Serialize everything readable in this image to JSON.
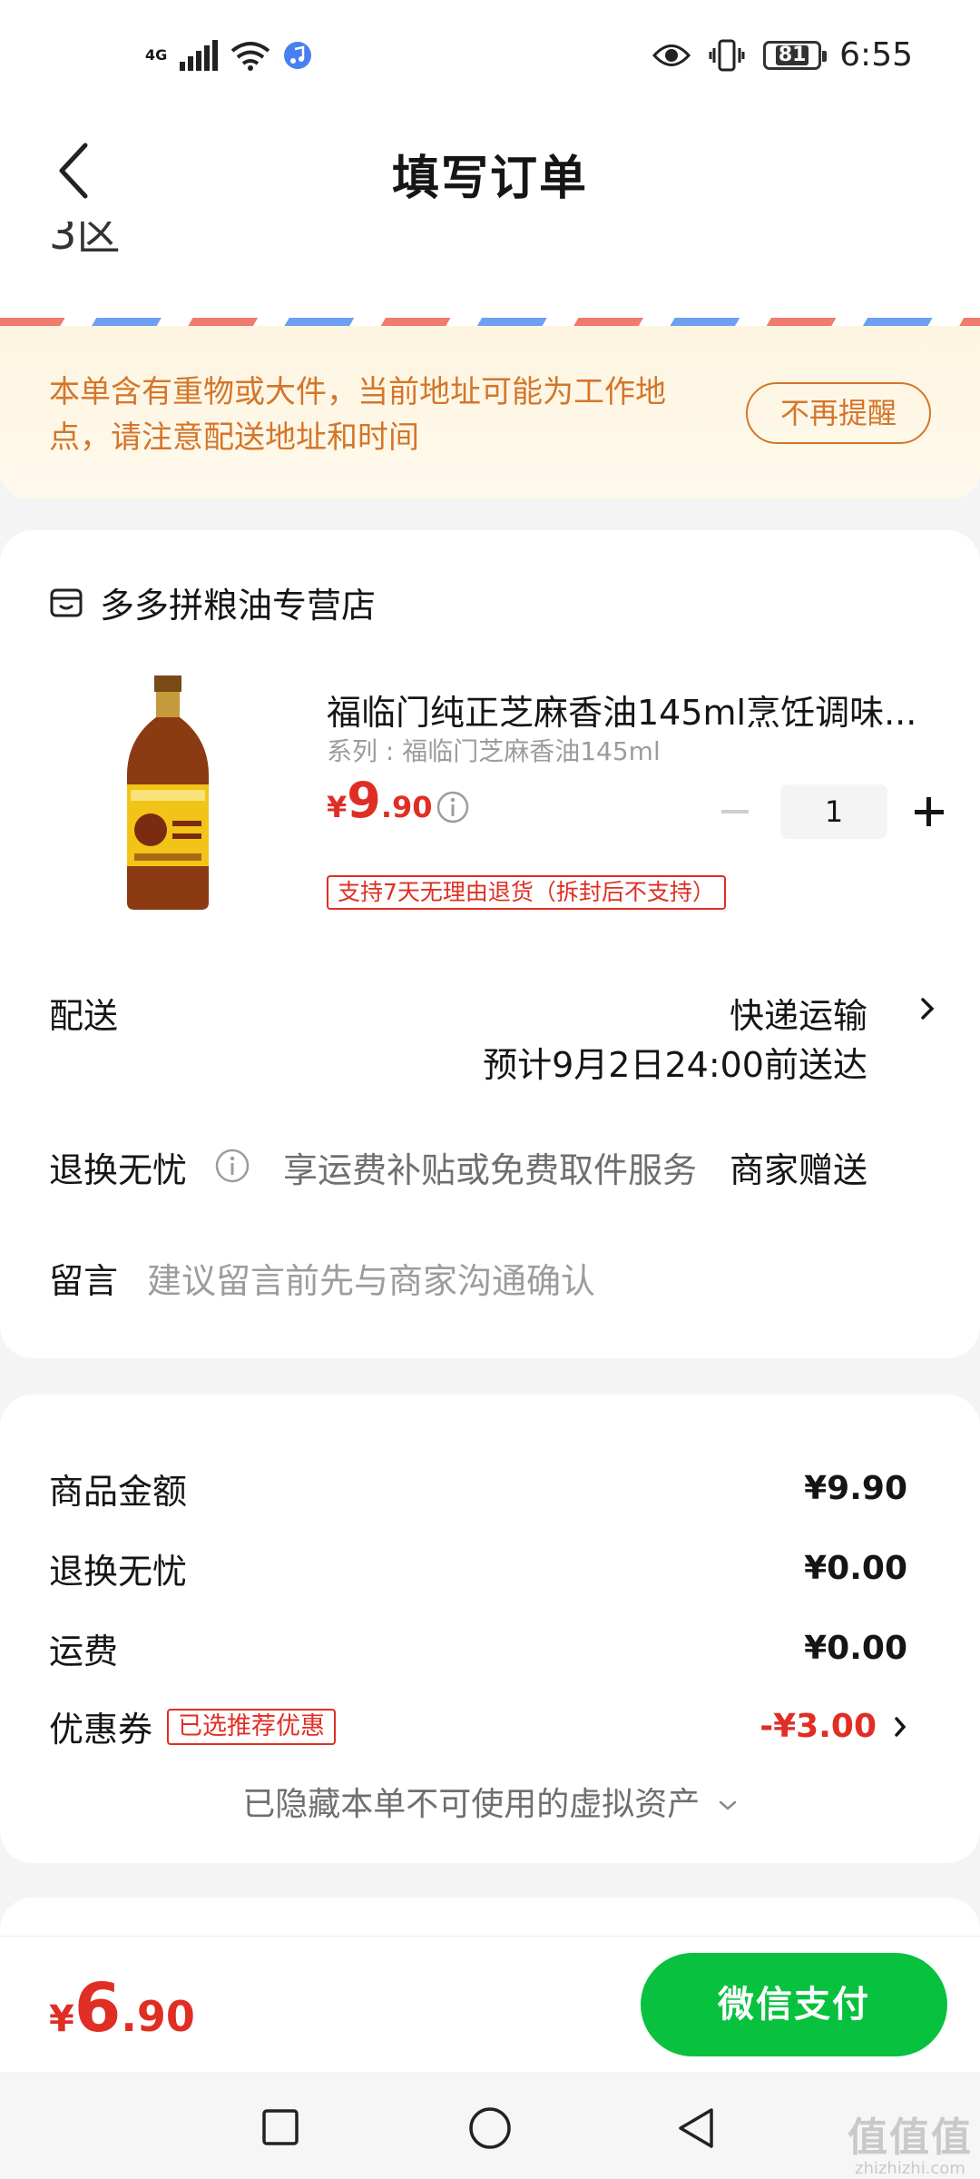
{
  "status_bar": {
    "network": "4G",
    "battery": "81",
    "time": "6:55"
  },
  "nav": {
    "title": "填写订单"
  },
  "address": {
    "partial_text": "3区"
  },
  "notice": {
    "text": "本单含有重物或大件，当前地址可能为工作地点，请注意配送地址和时间",
    "dismiss_label": "不再提醒"
  },
  "shop": {
    "name": "多多拼粮油专营店"
  },
  "product": {
    "title": "福临门纯正芝麻香油145ml烹饪调味...",
    "spec": "系列 : 福临门芝麻香油145ml",
    "price_currency": "¥",
    "price_int": "9",
    "price_dec": ".90",
    "quantity": "1",
    "return_tag": "支持7天无理由退货（拆封后不支持）"
  },
  "shipping": {
    "label": "配送",
    "method": "快递运输",
    "eta": "预计9月2日24:00前送达"
  },
  "worry_free": {
    "label": "退换无忧",
    "description": "享运费补贴或免费取件服务",
    "value": "商家赠送"
  },
  "message": {
    "label": "留言",
    "placeholder": "建议留言前先与商家沟通确认"
  },
  "summary": {
    "goods_label": "商品金额",
    "goods_value": "¥9.90",
    "worry_label": "退换无忧",
    "worry_value": "¥0.00",
    "freight_label": "运费",
    "freight_value": "¥0.00",
    "coupon_label": "优惠券",
    "coupon_tag": "已选推荐优惠",
    "coupon_value": "-¥3.00",
    "hidden_assets": "已隐藏本单不可使用的虚拟资产"
  },
  "footer": {
    "total_currency": "¥",
    "total_int": "6",
    "total_dec": ".90",
    "pay_label": "微信支付"
  },
  "watermark": {
    "big": "值值值",
    "small": "zhizhizhi.com"
  },
  "colors": {
    "accent_red": "#e02e24",
    "warning_orange": "#d4762a",
    "wechat_green": "#07c13f"
  }
}
